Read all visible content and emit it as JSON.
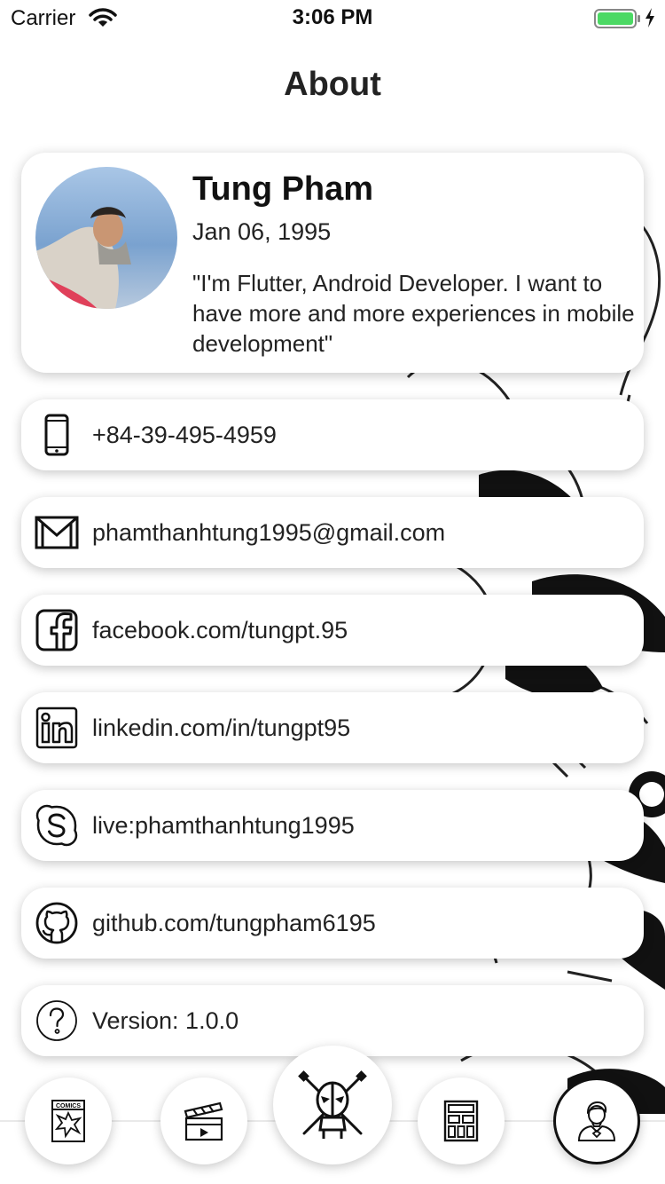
{
  "status_bar": {
    "carrier": "Carrier",
    "time": "3:06 PM",
    "icons": [
      "wifi-icon",
      "battery-icon",
      "charging-bolt-icon"
    ],
    "battery_color": "#4cd964"
  },
  "header": {
    "title": "About"
  },
  "profile": {
    "name": "Tung Pham",
    "birthdate": "Jan 06, 1995",
    "quote": "\"I'm Flutter, Android Developer. I want to have more and more experiences in mobile development\""
  },
  "contacts": [
    {
      "icon": "phone-icon",
      "label": "+84-39-495-4959"
    },
    {
      "icon": "mail-icon",
      "label": "phamthanhtung1995@gmail.com"
    },
    {
      "icon": "facebook-icon",
      "label": "facebook.com/tungpt.95"
    },
    {
      "icon": "linkedin-icon",
      "label": "linkedin.com/in/tungpt95"
    },
    {
      "icon": "skype-icon",
      "label": "live:phamthanhtung1995"
    },
    {
      "icon": "github-icon",
      "label": "github.com/tungpham6195"
    },
    {
      "icon": "help-icon",
      "label": "Version: 1.0.0"
    }
  ],
  "bottom_nav": {
    "items": [
      {
        "icon": "comics-book-icon",
        "label": "COMICS",
        "selected": false
      },
      {
        "icon": "clapperboard-icon",
        "selected": false
      },
      {
        "icon": "deadpool-icon",
        "selected": false,
        "center": true
      },
      {
        "icon": "grid-layout-icon",
        "selected": false
      },
      {
        "icon": "superhero-icon",
        "selected": true
      }
    ],
    "selected_border_color": "#111111"
  }
}
